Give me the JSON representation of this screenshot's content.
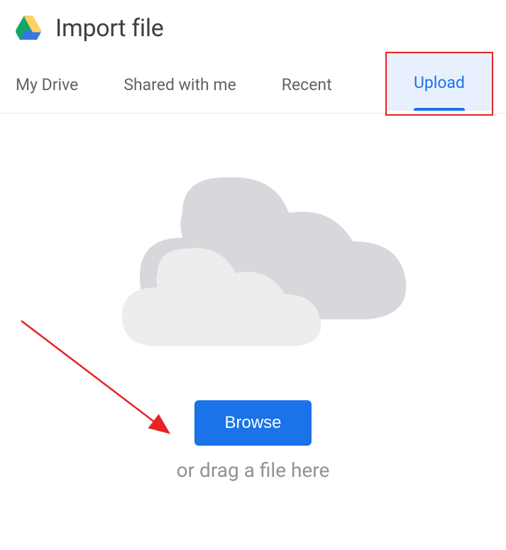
{
  "header": {
    "title": "Import file"
  },
  "tabs": {
    "my_drive": "My Drive",
    "shared": "Shared with me",
    "recent": "Recent",
    "upload": "Upload"
  },
  "upload_pane": {
    "browse_label": "Browse",
    "drag_text": "or drag a file here"
  }
}
